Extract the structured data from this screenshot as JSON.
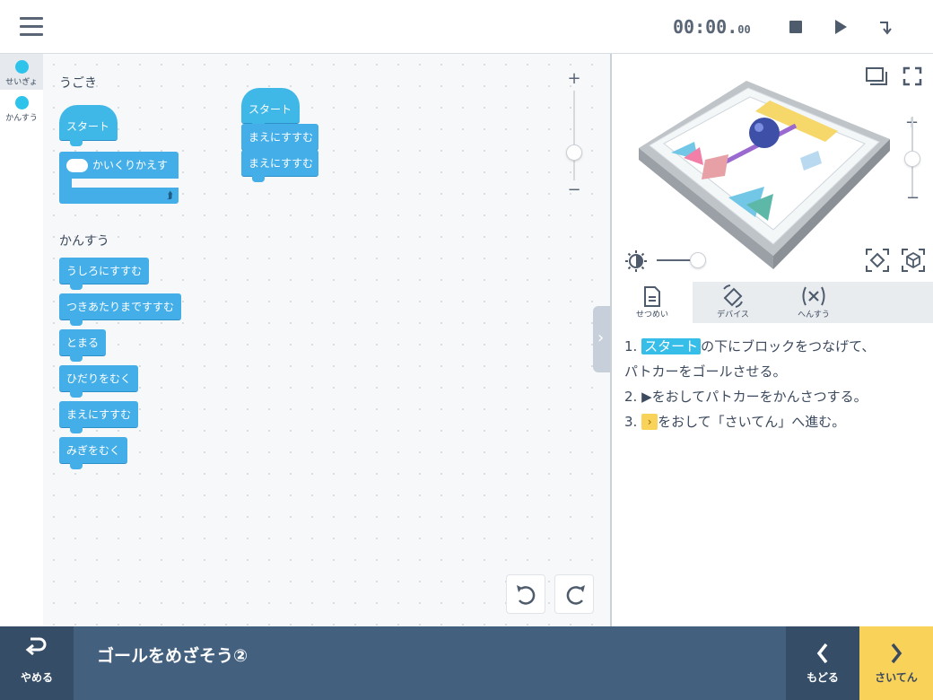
{
  "app": {
    "menu_icon": "hamburger-menu-icon",
    "timer_main": "00:00.",
    "timer_sub": "00",
    "toolbar_icons": [
      "stop-icon",
      "play-icon",
      "step-icon"
    ]
  },
  "categories": [
    {
      "label": "せいぎょ",
      "active": true,
      "color": "#2ec3ea"
    },
    {
      "label": "かんすう",
      "active": false,
      "color": "#2ec3ea"
    }
  ],
  "palette": {
    "section1_title": "うごき",
    "start_block": "スタート",
    "loop_block": "かいくりかえす",
    "section2_title": "かんすう",
    "blocks": [
      "うしろにすすむ",
      "つきあたりまですすむ",
      "とまる",
      "ひだりをむく",
      "まえにすすむ",
      "みぎをむく"
    ]
  },
  "program": {
    "hat": "スタート",
    "blocks": [
      "まえにすすむ",
      "まえにすすむ"
    ]
  },
  "zoom": {
    "plus": "+",
    "minus": "−",
    "level": 0.6
  },
  "stage": {
    "zoom_plus": "+",
    "zoom_minus": "−",
    "brightness_level": 0.8
  },
  "tabs": [
    {
      "label": "せつめい",
      "icon": "document-icon",
      "active": true
    },
    {
      "label": "デバイス",
      "icon": "device-icon",
      "active": false
    },
    {
      "label": "へんすう",
      "icon": "variable-icon",
      "active": false
    }
  ],
  "instructions": {
    "l1_num": "1.",
    "l1_hl": "スタート",
    "l1_rest": "の下にブロックをつなげて、",
    "l1b": "パトカーをゴールさせる。",
    "l2_num": "2.",
    "l2_icon": "▶",
    "l2_rest": "をおしてパトカーをかんさつする。",
    "l3_num": "3.",
    "l3_icon": "›",
    "l3_rest": "をおして「さいてん」へ進む。"
  },
  "bottom": {
    "quit_label": "やめる",
    "lesson_title": "ゴールをめざそう②",
    "back_label": "もどる",
    "next_label": "さいてん"
  },
  "colors": {
    "block_blue": "#44aee8",
    "hat_cyan": "#3fb8e8",
    "bottom_bar": "#44607f",
    "next_button": "#f9d25a"
  }
}
